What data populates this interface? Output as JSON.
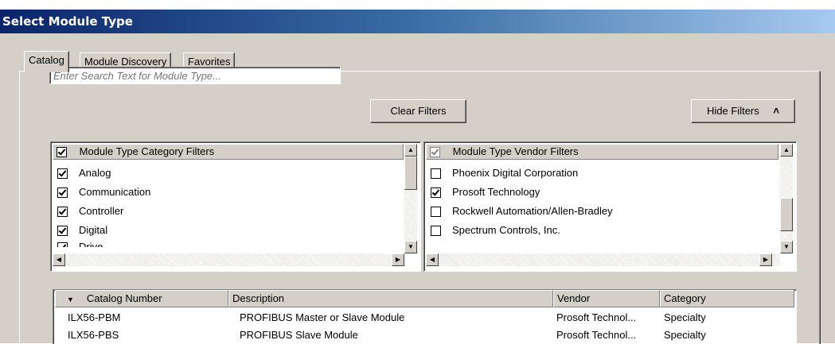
{
  "window": {
    "title": "Select Module Type"
  },
  "tabs": [
    {
      "label": "Catalog",
      "active": true
    },
    {
      "label": "Module Discovery",
      "active": false
    },
    {
      "label": "Favorites",
      "active": false
    }
  ],
  "search": {
    "placeholder": "Enter Search Text for Module Type..."
  },
  "buttons": {
    "clear_filters": "Clear Filters",
    "hide_filters": "Hide Filters",
    "hide_filters_icon": "double-chevron-up-icon"
  },
  "category_filters": {
    "header": "Module Type Category Filters",
    "header_checked": true,
    "items": [
      {
        "label": "Analog",
        "checked": true
      },
      {
        "label": "Communication",
        "checked": true
      },
      {
        "label": "Controller",
        "checked": true
      },
      {
        "label": "Digital",
        "checked": true
      },
      {
        "label": "Drive",
        "checked": true
      }
    ]
  },
  "vendor_filters": {
    "header": "Module Type Vendor Filters",
    "header_checked": true,
    "items": [
      {
        "label": "Phoenix Digital Corporation",
        "checked": false
      },
      {
        "label": "Prosoft Technology",
        "checked": true
      },
      {
        "label": "Rockwell Automation/Allen-Bradley",
        "checked": false
      },
      {
        "label": "Spectrum Controls, Inc.",
        "checked": false
      }
    ]
  },
  "catalog_table": {
    "sort_icon": "sort-down-icon",
    "columns": [
      "Catalog Number",
      "Description",
      "Vendor",
      "Category"
    ],
    "rows": [
      [
        "ILX56-PBM",
        "PROFIBUS Master or Slave Module",
        "Prosoft Technol...",
        "Specialty"
      ],
      [
        "ILX56-PBS",
        "PROFIBUS Slave Module",
        "Prosoft Technol...",
        "Specialty"
      ]
    ]
  }
}
